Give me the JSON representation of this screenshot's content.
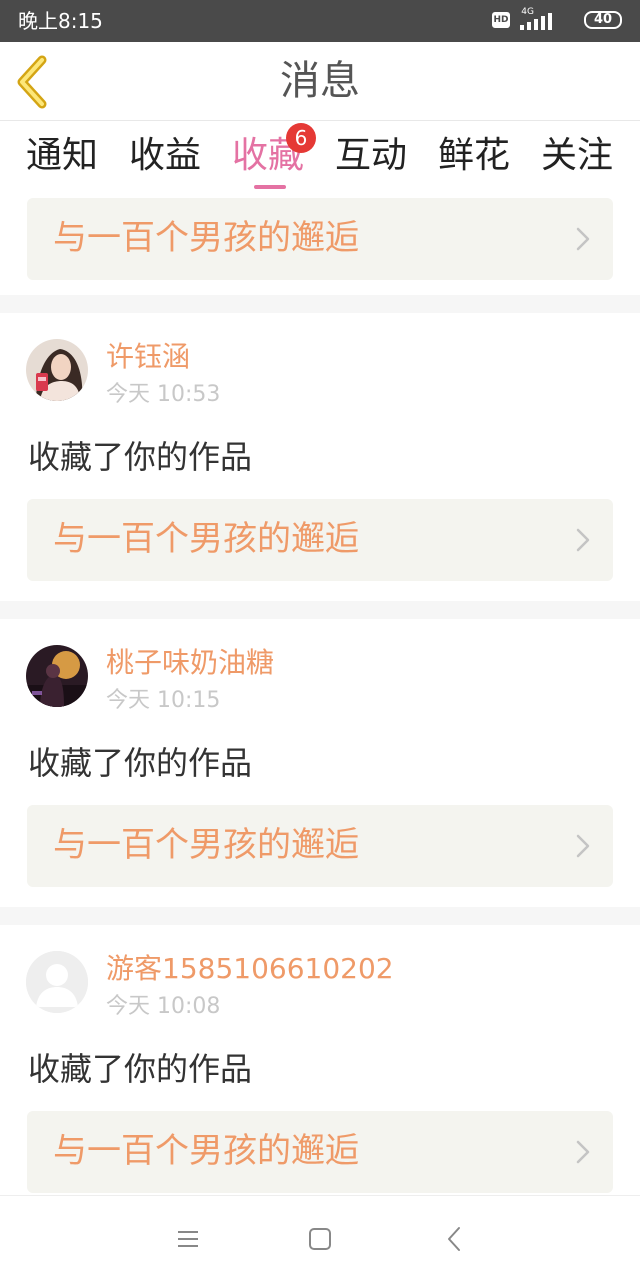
{
  "status_bar": {
    "time": "晚上8:15",
    "hd": "HD",
    "network": "4G",
    "battery": "40"
  },
  "header": {
    "title": "消息",
    "back_icon": "chevron-left-icon"
  },
  "tabs": [
    {
      "label": "通知"
    },
    {
      "label": "收益"
    },
    {
      "label": "收藏",
      "badge": "6",
      "active": true
    },
    {
      "label": "互动"
    },
    {
      "label": "鲜花"
    },
    {
      "label": "关注"
    }
  ],
  "colors": {
    "accent": "#e472a3",
    "name_orange": "#ef9a68",
    "badge_red": "#e53935",
    "card_bg": "#f4f4ef"
  },
  "top_partial_entry": {
    "work_title": "与一百个男孩的邂逅"
  },
  "entries": [
    {
      "username": "许钰涵",
      "time": "今天 10:53",
      "action": "收藏了你的作品",
      "work_title": "与一百个男孩的邂逅"
    },
    {
      "username": "桃子味奶油糖",
      "time": "今天 10:15",
      "action": "收藏了你的作品",
      "work_title": "与一百个男孩的邂逅"
    },
    {
      "username": "游客1585106610202",
      "time": "今天 10:08",
      "action": "收藏了你的作品",
      "work_title": "与一百个男孩的邂逅"
    }
  ],
  "nav": {
    "menu_icon": "menu-icon",
    "home_icon": "home-square-icon",
    "back_icon": "back-triangle-icon"
  }
}
